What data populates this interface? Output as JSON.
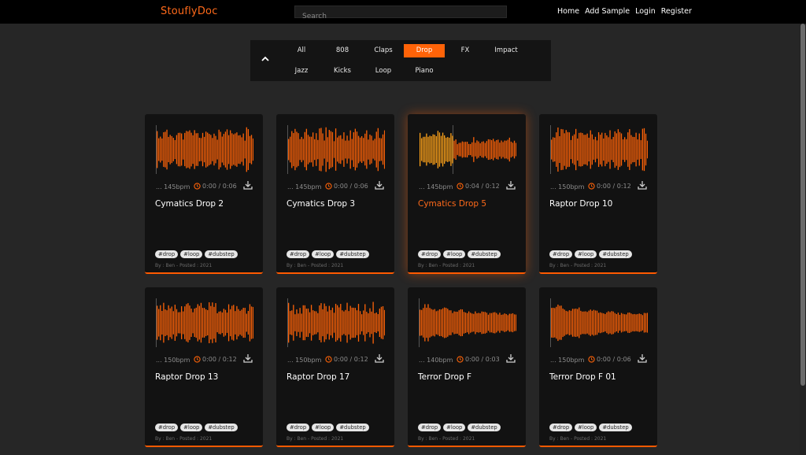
{
  "navbar": {
    "brand": "StouflyDoc",
    "search_placeholder": "Search",
    "links": [
      "Home",
      "Add Sample",
      "Login",
      "Register"
    ]
  },
  "filters": {
    "row1": [
      "All",
      "808",
      "Claps",
      "Drop",
      "FX",
      "Impact"
    ],
    "row2": [
      "Jazz",
      "Kicks",
      "Loop",
      "Piano"
    ],
    "active": "Drop",
    "collapse_icon": "chevron-up-icon"
  },
  "colors": {
    "accent": "#ff6308",
    "played": "#ffa31a",
    "card": "#121212",
    "page": "#262626"
  },
  "cards": [
    {
      "title": "Cymatics Drop 2",
      "bpm": "... 145bpm",
      "time": "0:00 / 0:06",
      "played": 0,
      "tags": [
        "#drop",
        "#loop",
        "#dubstep"
      ],
      "byline": "By : Ben - Posted : 2021"
    },
    {
      "title": "Cymatics Drop 3",
      "bpm": "... 145bpm",
      "time": "0:00 / 0:06",
      "played": 0,
      "tags": [
        "#drop",
        "#loop",
        "#dubstep"
      ],
      "byline": "By : Ben - Posted : 2021"
    },
    {
      "title": "Cymatics Drop 5",
      "bpm": "... 145bpm",
      "time": "0:04 / 0:12",
      "played": 0.35,
      "tags": [
        "#drop",
        "#loop",
        "#dubstep"
      ],
      "byline": "By : Ben - Posted : 2021"
    },
    {
      "title": "Raptor Drop 10",
      "bpm": "... 150bpm",
      "time": "0:00 / 0:12",
      "played": 0,
      "tags": [
        "#drop",
        "#loop",
        "#dubstep"
      ],
      "byline": "By : Ben - Posted : 2021"
    },
    {
      "title": "Raptor Drop 13",
      "bpm": "... 150bpm",
      "time": "0:00 / 0:12",
      "played": 0,
      "tags": [
        "#drop",
        "#loop",
        "#dubstep"
      ],
      "byline": "By : Ben - Posted : 2021"
    },
    {
      "title": "Raptor Drop 17",
      "bpm": "... 150bpm",
      "time": "0:00 / 0:12",
      "played": 0,
      "tags": [
        "#drop",
        "#loop",
        "#dubstep"
      ],
      "byline": "By : Ben - Posted : 2021"
    },
    {
      "title": "Terror Drop F",
      "bpm": "... 140bpm",
      "time": "0:00 / 0:03",
      "played": 0,
      "tags": [
        "#drop",
        "#loop",
        "#dubstep"
      ],
      "byline": "By : Ben - Posted : 2021"
    },
    {
      "title": "Terror Drop F 01",
      "bpm": "... 150bpm",
      "time": "0:00 / 0:06",
      "played": 0,
      "tags": [
        "#drop",
        "#loop",
        "#dubstep"
      ],
      "byline": "By : Ben - Posted : 2021"
    }
  ]
}
